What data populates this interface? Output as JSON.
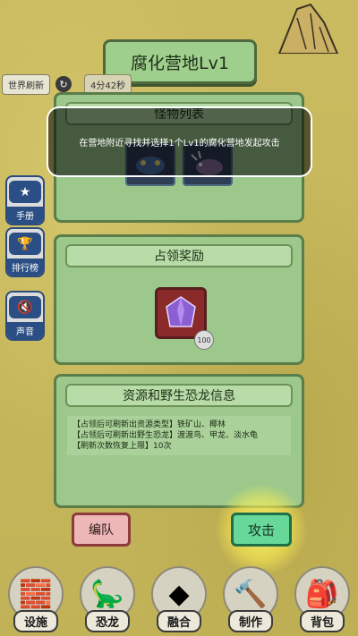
{
  "title": "腐化营地Lv1",
  "refresh": {
    "label": "世界刷新",
    "timer": "4分42秒"
  },
  "monster_list": {
    "header": "怪物列表"
  },
  "tooltip_text": "在营地附近寻找并选择1个Lv1的腐化营地发起攻击",
  "reward": {
    "header": "占领奖励",
    "count": "100",
    "item_icon": "purple-crystal-icon"
  },
  "info": {
    "header": "资源和野生恐龙信息",
    "lines": [
      "【占领后可刷新出资源类型】铁矿山、椰林",
      "【占领后可刷新出野生恐龙】渡渡鸟、甲龙、淡水龟",
      "【刷新次数恢复上限】10次"
    ]
  },
  "side_buttons": [
    {
      "label": "手册",
      "icon": "book-star-icon"
    },
    {
      "label": "排行榜",
      "icon": "trophy-icon"
    },
    {
      "label": "声音",
      "icon": "speaker-mute-icon"
    }
  ],
  "actions": {
    "edit_label": "编队",
    "attack_label": "攻击"
  },
  "bottom_nav": [
    {
      "label": "设施",
      "icon": "fence-icon"
    },
    {
      "label": "恐龙",
      "icon": "dinosaur-globe-icon"
    },
    {
      "label": "融合",
      "icon": "fusion-icon"
    },
    {
      "label": "制作",
      "icon": "hammer-icon"
    },
    {
      "label": "背包",
      "icon": "backpack-icon"
    }
  ],
  "colors": {
    "background": "#c9b85c",
    "panel": "#9cc88c",
    "attack_button": "#68d79a",
    "edit_button": "#eeb7b7",
    "side_button": "#2b4f84"
  }
}
